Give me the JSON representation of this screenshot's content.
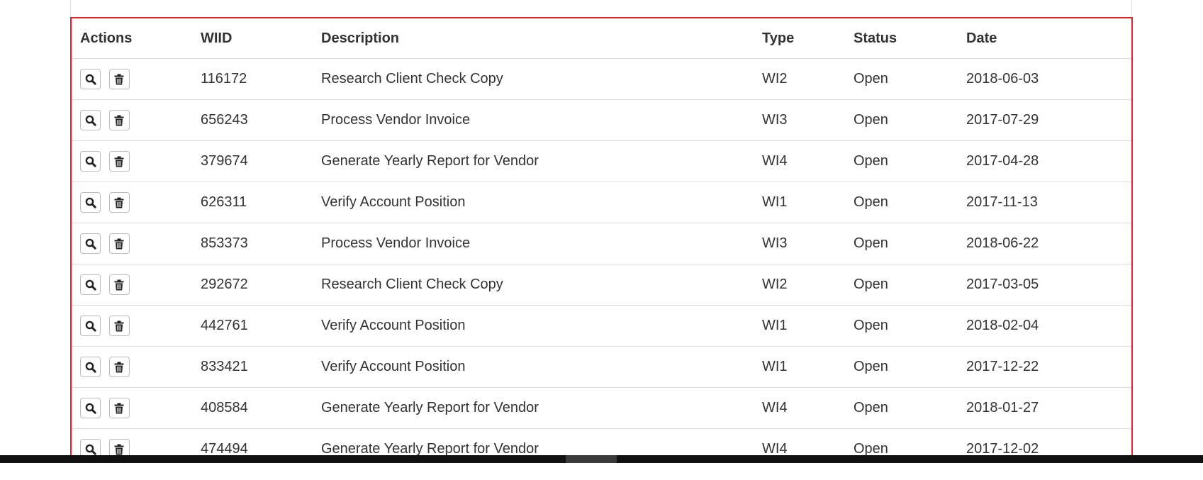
{
  "table": {
    "headers": {
      "actions": "Actions",
      "wiid": "WIID",
      "description": "Description",
      "type": "Type",
      "status": "Status",
      "date": "Date"
    },
    "rows": [
      {
        "wiid": "116172",
        "description": "Research Client Check Copy",
        "type": "WI2",
        "status": "Open",
        "date": "2018-06-03"
      },
      {
        "wiid": "656243",
        "description": "Process Vendor Invoice",
        "type": "WI3",
        "status": "Open",
        "date": "2017-07-29"
      },
      {
        "wiid": "379674",
        "description": "Generate Yearly Report for Vendor",
        "type": "WI4",
        "status": "Open",
        "date": "2017-04-28"
      },
      {
        "wiid": "626311",
        "description": "Verify Account Position",
        "type": "WI1",
        "status": "Open",
        "date": "2017-11-13"
      },
      {
        "wiid": "853373",
        "description": "Process Vendor Invoice",
        "type": "WI3",
        "status": "Open",
        "date": "2018-06-22"
      },
      {
        "wiid": "292672",
        "description": "Research Client Check Copy",
        "type": "WI2",
        "status": "Open",
        "date": "2017-03-05"
      },
      {
        "wiid": "442761",
        "description": "Verify Account Position",
        "type": "WI1",
        "status": "Open",
        "date": "2018-02-04"
      },
      {
        "wiid": "833421",
        "description": "Verify Account Position",
        "type": "WI1",
        "status": "Open",
        "date": "2017-12-22"
      },
      {
        "wiid": "408584",
        "description": "Generate Yearly Report for Vendor",
        "type": "WI4",
        "status": "Open",
        "date": "2018-01-27"
      },
      {
        "wiid": "474494",
        "description": "Generate Yearly Report for Vendor",
        "type": "WI4",
        "status": "Open",
        "date": "2017-12-02"
      }
    ]
  },
  "icons": {
    "view": "magnifier-icon",
    "delete": "trash-icon"
  },
  "colors": {
    "highlight_border": "#e8212e",
    "row_divider": "#dddddd",
    "text": "#333333"
  }
}
